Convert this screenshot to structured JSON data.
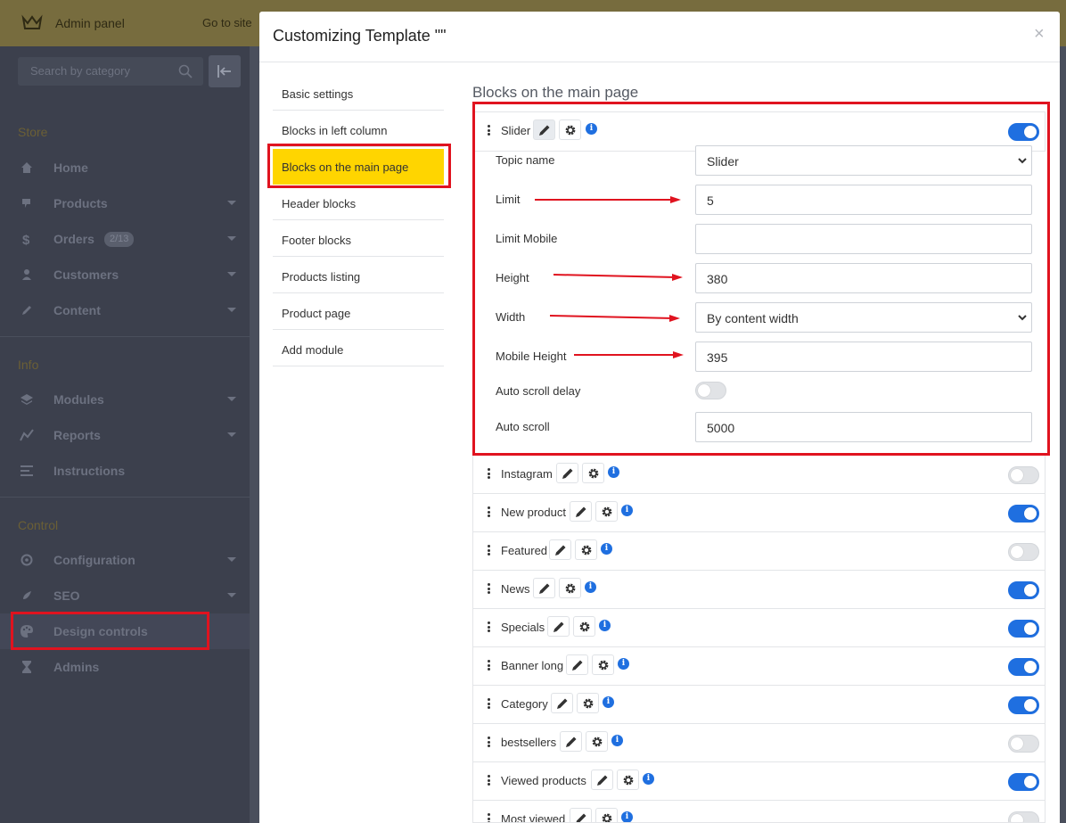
{
  "topbar": {
    "brand": "Admin panel",
    "goto": "Go to site"
  },
  "sidebar": {
    "search_placeholder": "Search by category",
    "sections": [
      {
        "title": "Store",
        "items": [
          {
            "label": "Home",
            "icon": "home-icon"
          },
          {
            "label": "Products",
            "icon": "tag-icon",
            "caret": true
          },
          {
            "label": "Orders",
            "icon": "dollar-icon",
            "badge": "2/13",
            "caret": true
          },
          {
            "label": "Customers",
            "icon": "user-icon",
            "caret": true
          },
          {
            "label": "Content",
            "icon": "pencil-icon",
            "caret": true
          }
        ]
      },
      {
        "title": "Info",
        "items": [
          {
            "label": "Modules",
            "icon": "layers-icon",
            "caret": true
          },
          {
            "label": "Reports",
            "icon": "chart-line-icon",
            "caret": true
          },
          {
            "label": "Instructions",
            "icon": "list-icon"
          }
        ]
      },
      {
        "title": "Control",
        "items": [
          {
            "label": "Configuration",
            "icon": "cog-icon",
            "caret": true
          },
          {
            "label": "SEO",
            "icon": "rocket-icon",
            "caret": true
          },
          {
            "label": "Design controls",
            "icon": "palette-icon",
            "active": true
          },
          {
            "label": "Admins",
            "icon": "hourglass-icon"
          }
        ]
      }
    ]
  },
  "modal": {
    "title": "Customizing Template \"\"",
    "close": "×",
    "tabs": [
      "Basic settings",
      "Blocks in left column",
      "Blocks on the main page",
      "Header blocks",
      "Footer blocks",
      "Products listing",
      "Product page",
      "Add module"
    ],
    "active_tab": "Blocks on the main page",
    "content_title": "Blocks on the main page",
    "slider": {
      "name": "Slider",
      "enabled": true,
      "fields": [
        {
          "label": "Topic name",
          "value": "Slider",
          "type": "select"
        },
        {
          "label": "Limit",
          "value": "5",
          "type": "input"
        },
        {
          "label": "Limit Mobile",
          "value": "",
          "type": "input"
        },
        {
          "label": "Height",
          "value": "380",
          "type": "input"
        },
        {
          "label": "Width",
          "value": "By content width",
          "type": "select"
        },
        {
          "label": "Mobile Height",
          "value": "395",
          "type": "input"
        },
        {
          "label": "Auto scroll delay",
          "value": "off",
          "type": "toggle"
        },
        {
          "label": "Auto scroll",
          "value": "5000",
          "type": "input"
        }
      ]
    },
    "blocks": [
      {
        "name": "Instagram",
        "enabled": false
      },
      {
        "name": "New product",
        "enabled": true
      },
      {
        "name": "Featured",
        "enabled": false
      },
      {
        "name": "News",
        "enabled": true
      },
      {
        "name": "Specials",
        "enabled": true
      },
      {
        "name": "Banner long",
        "enabled": true
      },
      {
        "name": "Category",
        "enabled": true
      },
      {
        "name": "bestsellers",
        "enabled": false
      },
      {
        "name": "Viewed products",
        "enabled": true
      },
      {
        "name": "Most viewed",
        "enabled": false
      }
    ]
  },
  "colors": {
    "accent": "#1f6fe0",
    "highlight": "#ffd500",
    "annotation": "#e0131f"
  }
}
